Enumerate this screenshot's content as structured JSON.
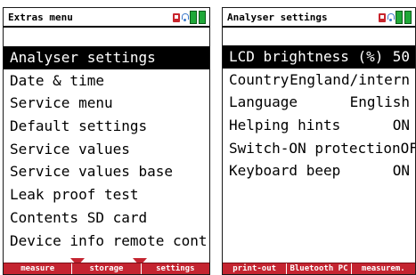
{
  "left": {
    "title": "Extras menu",
    "items": [
      {
        "label": "Analyser settings",
        "selected": true
      },
      {
        "label": "Date & time"
      },
      {
        "label": "Service menu"
      },
      {
        "label": "Default settings"
      },
      {
        "label": "Service values"
      },
      {
        "label": "Service values base"
      },
      {
        "label": "Leak proof test"
      },
      {
        "label": "Contents SD card"
      },
      {
        "label": "Device info remote control"
      }
    ],
    "softkeys": [
      "measure",
      "storage",
      "settings"
    ]
  },
  "right": {
    "title": "Analyser settings",
    "items": [
      {
        "label": "LCD brightness (%)",
        "value": "50",
        "selected": true
      },
      {
        "label": "Country",
        "value": "England/intern"
      },
      {
        "label": "Language",
        "value": "English"
      },
      {
        "label": "Helping hints",
        "value": "ON"
      },
      {
        "label": "Switch-ON protection",
        "value": "OFF"
      },
      {
        "label": "Keyboard beep",
        "value": "ON"
      }
    ],
    "softkeys": [
      "print-out",
      "Bluetooth PC",
      "measurem."
    ]
  },
  "colors": {
    "accent": "#c42430",
    "battery": "#1fa838",
    "bluetooth": "#3a78c8",
    "sd": "#c8242c"
  },
  "icons": [
    "sd-card-icon",
    "bluetooth-icon",
    "battery-icon"
  ]
}
